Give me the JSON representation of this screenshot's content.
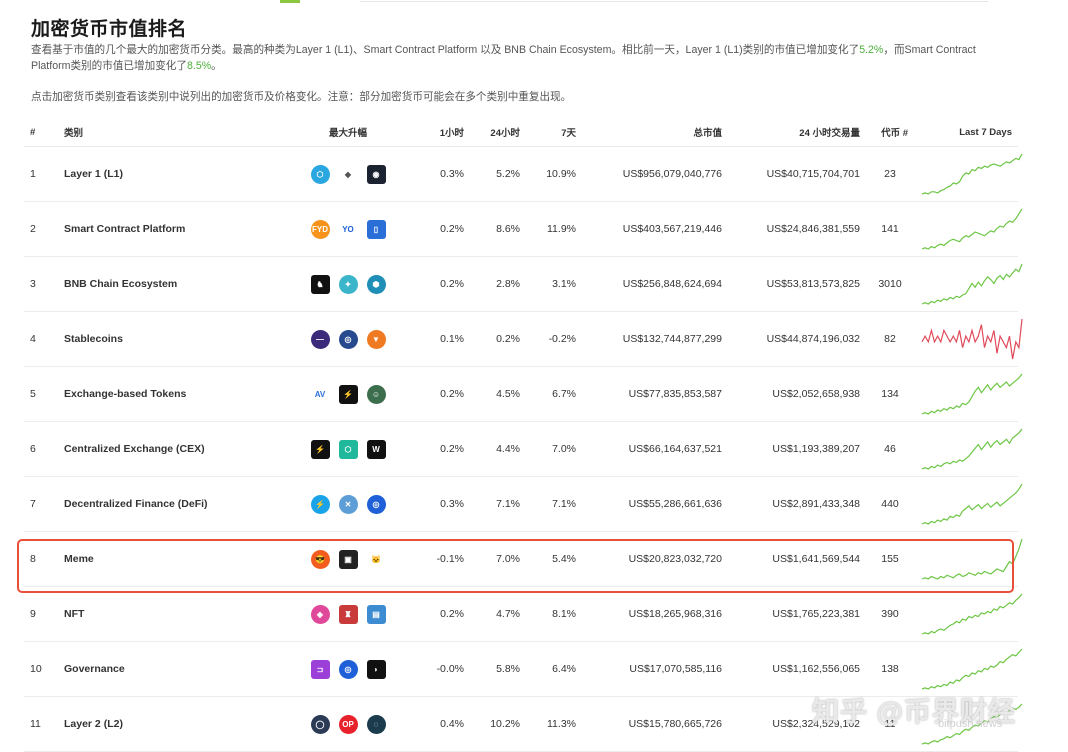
{
  "page": {
    "title": "加密货币市值排名",
    "desc_a": "查看基于市值的几个最大的加密货币分类。最高的种类为Layer 1 (L1)、Smart Contract Platform 以及 BNB Chain Ecosystem。相比前一天，Layer 1 (L1)类别的市值已增加变化了",
    "desc_v1": "5.2%",
    "desc_b": "，而Smart Contract Platform类别的市值已增加变化了",
    "desc_v2": "8.5%",
    "desc_c": "。",
    "note": "点击加密货币类别查看该类别中说列出的加密货币及价格变化。注意：部分加密货币可能会在多个类别中重复出现。"
  },
  "table": {
    "headers": {
      "rank": "#",
      "category": "类别",
      "gainers": "最大升幅",
      "h1": "1小时",
      "h24": "24小时",
      "d7": "7天",
      "mcap": "总市值",
      "vol": "24 小时交易量",
      "coins": "代币 #",
      "spark": "Last 7 Days"
    },
    "rows": [
      {
        "rank": "1",
        "name": "Layer 1 (L1)",
        "h1": "0.3%",
        "h24": "5.2%",
        "d7": "10.9%",
        "mcap": "US$956,079,040,776",
        "vol": "US$40,715,704,701",
        "coins": "23",
        "icons": [
          {
            "name": "cube-token-icon",
            "bg": "#2aa7e0",
            "glyph": "⬡",
            "sq": false
          },
          {
            "name": "ethereum-icon",
            "bg": "#ffffff",
            "fg": "#555",
            "glyph": "◆",
            "sq": false,
            "plain": true
          },
          {
            "name": "dark-token-icon",
            "bg": "#1b2330",
            "glyph": "◉",
            "sq": true
          }
        ],
        "spark": [
          4,
          5,
          4,
          6,
          6,
          5,
          7,
          8,
          10,
          11,
          14,
          13,
          15,
          20,
          23,
          22,
          26,
          25,
          28,
          27,
          29,
          28,
          30,
          31,
          30,
          29,
          31,
          33,
          32,
          34,
          36,
          35,
          40
        ]
      },
      {
        "rank": "2",
        "name": "Smart Contract Platform",
        "h1": "0.2%",
        "h24": "8.6%",
        "d7": "11.9%",
        "mcap": "US$403,567,219,446",
        "vol": "US$24,846,381,559",
        "coins": "141",
        "icons": [
          {
            "name": "fyd-token-icon",
            "bg": "#f7931a",
            "glyph": "FYD",
            "sq": false
          },
          {
            "name": "yo-token-icon",
            "bg": "#ffffff",
            "fg": "#1b5fd8",
            "glyph": "YO",
            "sq": false,
            "plain": true
          },
          {
            "name": "blue-token-icon",
            "bg": "#2a6fd8",
            "glyph": "▯",
            "sq": true
          }
        ],
        "spark": [
          5,
          6,
          5,
          7,
          6,
          8,
          9,
          8,
          10,
          12,
          13,
          12,
          11,
          14,
          16,
          15,
          17,
          19,
          18,
          17,
          16,
          18,
          20,
          19,
          22,
          24,
          23,
          26,
          28,
          27,
          30,
          34,
          38
        ]
      },
      {
        "rank": "3",
        "name": "BNB Chain Ecosystem",
        "h1": "0.2%",
        "h24": "2.8%",
        "d7": "3.1%",
        "mcap": "US$256,848,624,694",
        "vol": "US$53,813,573,825",
        "coins": "3010",
        "icons": [
          {
            "name": "black-token-icon",
            "bg": "#111111",
            "glyph": "♞",
            "sq": true
          },
          {
            "name": "teal-token-icon",
            "bg": "#3ab5c9",
            "glyph": "✦",
            "sq": false
          },
          {
            "name": "hexagon-token-icon",
            "bg": "#1f8fb8",
            "glyph": "⬢",
            "sq": false
          }
        ],
        "spark": [
          6,
          7,
          6,
          8,
          7,
          9,
          8,
          10,
          9,
          11,
          10,
          12,
          11,
          13,
          14,
          18,
          22,
          19,
          23,
          20,
          24,
          27,
          25,
          22,
          26,
          28,
          25,
          29,
          27,
          30,
          33,
          31,
          37
        ]
      },
      {
        "rank": "4",
        "name": "Stablecoins",
        "h1": "0.1%",
        "h24": "0.2%",
        "d7": "-0.2%",
        "mcap": "US$132,744,877,299",
        "vol": "US$44,874,196,032",
        "coins": "82",
        "icons": [
          {
            "name": "purple-token-icon",
            "bg": "#3b2a7a",
            "glyph": "—",
            "sq": false
          },
          {
            "name": "navy-token-icon",
            "bg": "#274a8e",
            "glyph": "◎",
            "sq": false
          },
          {
            "name": "orange-token-icon",
            "bg": "#f07a22",
            "glyph": "▼",
            "sq": false
          }
        ],
        "spark": [
          20,
          21,
          20,
          22,
          20,
          21,
          20,
          22,
          21,
          20,
          21,
          20,
          22,
          19,
          21,
          20,
          22,
          20,
          21,
          23,
          19,
          21,
          20,
          22,
          18,
          21,
          20,
          19,
          21,
          17,
          20,
          19,
          24
        ]
      },
      {
        "rank": "5",
        "name": "Exchange-based Tokens",
        "h1": "0.2%",
        "h24": "4.5%",
        "d7": "6.7%",
        "mcap": "US$77,835,853,587",
        "vol": "US$2,052,658,938",
        "coins": "134",
        "icons": [
          {
            "name": "av-token-icon",
            "bg": "#ffffff",
            "fg": "#2a6fd8",
            "glyph": "AV",
            "sq": false,
            "plain": true
          },
          {
            "name": "black-red-token-icon",
            "bg": "#111111",
            "fg": "#e2453c",
            "glyph": "⚡",
            "sq": true
          },
          {
            "name": "green-face-token-icon",
            "bg": "#3c6e4e",
            "glyph": "☺",
            "sq": false
          }
        ],
        "spark": [
          5,
          6,
          5,
          7,
          6,
          8,
          7,
          9,
          8,
          10,
          9,
          11,
          10,
          13,
          12,
          14,
          18,
          22,
          25,
          21,
          24,
          27,
          23,
          26,
          28,
          25,
          27,
          29,
          26,
          28,
          30,
          32,
          35
        ]
      },
      {
        "rank": "6",
        "name": "Centralized Exchange (CEX)",
        "h1": "0.2%",
        "h24": "4.4%",
        "d7": "7.0%",
        "mcap": "US$66,164,637,521",
        "vol": "US$1,193,389,207",
        "coins": "46",
        "icons": [
          {
            "name": "black-red-cex-icon",
            "bg": "#111111",
            "fg": "#e2453c",
            "glyph": "⚡",
            "sq": true
          },
          {
            "name": "green-cube-icon",
            "bg": "#1fb89a",
            "glyph": "⬡",
            "sq": true
          },
          {
            "name": "w-token-icon",
            "bg": "#111111",
            "glyph": "W",
            "sq": true
          }
        ],
        "spark": [
          5,
          6,
          5,
          7,
          6,
          8,
          7,
          9,
          10,
          9,
          11,
          10,
          12,
          11,
          13,
          15,
          18,
          21,
          24,
          20,
          23,
          26,
          22,
          25,
          27,
          24,
          26,
          28,
          25,
          29,
          31,
          33,
          36
        ]
      },
      {
        "rank": "7",
        "name": "Decentralized Finance (DeFi)",
        "h1": "0.3%",
        "h24": "7.1%",
        "d7": "7.1%",
        "mcap": "US$55,286,661,636",
        "vol": "US$2,891,433,348",
        "coins": "440",
        "icons": [
          {
            "name": "bolt-token-icon",
            "bg": "#1aa3e8",
            "glyph": "⚡",
            "sq": false
          },
          {
            "name": "x-token-icon",
            "bg": "#5e9ed6",
            "glyph": "✕",
            "sq": false
          },
          {
            "name": "blue-ring-token-icon",
            "bg": "#1f5fd8",
            "glyph": "◎",
            "sq": false
          }
        ],
        "spark": [
          6,
          7,
          6,
          8,
          7,
          9,
          8,
          10,
          9,
          12,
          11,
          13,
          12,
          16,
          18,
          20,
          17,
          19,
          21,
          18,
          20,
          22,
          19,
          21,
          23,
          20,
          22,
          24,
          26,
          28,
          30,
          33,
          37
        ]
      },
      {
        "rank": "8",
        "name": "Meme",
        "h1": "-0.1%",
        "h24": "7.0%",
        "d7": "5.4%",
        "mcap": "US$20,823,032,720",
        "vol": "US$1,641,569,544",
        "coins": "155",
        "icons": [
          {
            "name": "sunglasses-token-icon",
            "bg": "#f25c1f",
            "glyph": "😎",
            "sq": false
          },
          {
            "name": "dark-square-token-icon",
            "bg": "#222222",
            "glyph": "▣",
            "sq": true
          },
          {
            "name": "cat-face-token-icon",
            "bg": "#ffffff",
            "fg": "#333",
            "glyph": "🐱",
            "sq": false,
            "plain": true
          }
        ],
        "spark": [
          8,
          9,
          8,
          10,
          9,
          8,
          10,
          9,
          11,
          10,
          9,
          11,
          12,
          10,
          11,
          13,
          12,
          11,
          13,
          12,
          14,
          13,
          12,
          14,
          16,
          15,
          14,
          18,
          22,
          20,
          26,
          32,
          40
        ]
      },
      {
        "rank": "9",
        "name": "NFT",
        "h1": "0.2%",
        "h24": "4.7%",
        "d7": "8.1%",
        "mcap": "US$18,265,968,316",
        "vol": "US$1,765,223,381",
        "coins": "390",
        "icons": [
          {
            "name": "pink-token-icon",
            "bg": "#e0489a",
            "glyph": "◈",
            "sq": false
          },
          {
            "name": "red-creature-token-icon",
            "bg": "#c93b3b",
            "glyph": "♜",
            "sq": true
          },
          {
            "name": "pixel-token-icon",
            "bg": "#3d8bd0",
            "glyph": "▤",
            "sq": true
          }
        ],
        "spark": [
          5,
          6,
          5,
          7,
          6,
          8,
          9,
          8,
          10,
          12,
          13,
          15,
          14,
          17,
          16,
          19,
          18,
          20,
          19,
          22,
          21,
          23,
          22,
          25,
          24,
          27,
          26,
          28,
          30,
          29,
          32,
          34,
          37
        ]
      },
      {
        "rank": "10",
        "name": "Governance",
        "h1": "-0.0%",
        "h24": "5.8%",
        "d7": "6.4%",
        "mcap": "US$17,070,585,116",
        "vol": "US$1,162,556,065",
        "coins": "138",
        "icons": [
          {
            "name": "purple-square-token-icon",
            "bg": "#9b3fd8",
            "glyph": "⊐",
            "sq": true
          },
          {
            "name": "blue-ring-gov-icon",
            "bg": "#1f5fd8",
            "glyph": "◎",
            "sq": false
          },
          {
            "name": "black-curve-token-icon",
            "bg": "#111111",
            "glyph": "◗",
            "sq": true
          }
        ],
        "spark": [
          5,
          6,
          5,
          7,
          6,
          8,
          7,
          9,
          8,
          11,
          10,
          13,
          12,
          15,
          17,
          16,
          19,
          18,
          21,
          20,
          23,
          22,
          25,
          24,
          26,
          29,
          28,
          31,
          33,
          35,
          34,
          37,
          40
        ]
      },
      {
        "rank": "11",
        "name": "Layer 2 (L2)",
        "h1": "0.4%",
        "h24": "10.2%",
        "d7": "11.3%",
        "mcap": "US$15,780,665,726",
        "vol": "US$2,324,529,102",
        "coins": "11",
        "icons": [
          {
            "name": "ring-token-icon",
            "bg": "#2b3a55",
            "glyph": "◯",
            "sq": false
          },
          {
            "name": "op-token-icon",
            "bg": "#e8202a",
            "glyph": "OP",
            "sq": false
          },
          {
            "name": "teal-swirl-token-icon",
            "bg": "#1b3c4d",
            "glyph": "◌",
            "sq": false
          }
        ],
        "spark": [
          4,
          5,
          4,
          6,
          7,
          6,
          8,
          9,
          11,
          10,
          12,
          14,
          13,
          16,
          18,
          17,
          20,
          22,
          21,
          24,
          26,
          25,
          28,
          30,
          29,
          32,
          34,
          33,
          36,
          38,
          37,
          39,
          42
        ]
      }
    ],
    "highlight_row": "8"
  },
  "colors": {
    "up": "#6cc644",
    "down": "#e04a5a"
  },
  "watermark": {
    "main": "知乎 @币界财经",
    "sub": "bitpush.news"
  }
}
